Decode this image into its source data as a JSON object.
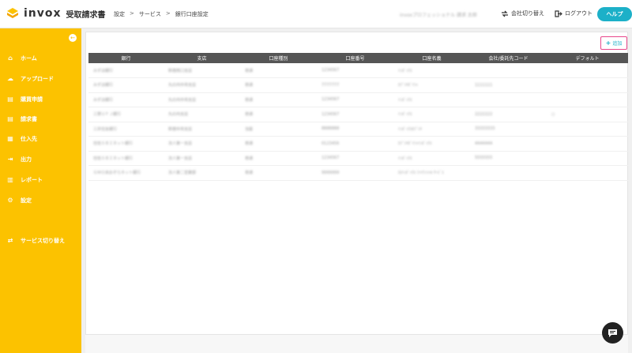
{
  "header": {
    "logo_text": "invox",
    "logo_sub": "受取請求書",
    "breadcrumb": [
      "設定",
      "サービス",
      "銀行口座設定"
    ],
    "breadcrumb_sep": ">",
    "user_name": "invoxプロフェッショナル 請求 太郎",
    "switch_company": "会社切り替え",
    "logout": "ログアウト",
    "help": "ヘルプ"
  },
  "sidebar": {
    "collapse_glyph": "←",
    "items": [
      {
        "label": "ホーム",
        "icon": "home-icon",
        "glyph": "⌂"
      },
      {
        "label": "アップロード",
        "icon": "upload-icon",
        "glyph": "☁"
      },
      {
        "label": "購買申請",
        "icon": "purchase-request-icon",
        "glyph": "▤"
      },
      {
        "label": "請求書",
        "icon": "invoice-icon",
        "glyph": "▤"
      },
      {
        "label": "仕入先",
        "icon": "supplier-icon",
        "glyph": "▦"
      },
      {
        "label": "出力",
        "icon": "export-icon",
        "glyph": "⇥"
      },
      {
        "label": "レポート",
        "icon": "report-icon",
        "glyph": "▥"
      },
      {
        "label": "設定",
        "icon": "settings-icon",
        "glyph": "⚙"
      },
      {
        "label": "サービス切り替え",
        "icon": "service-switch-icon",
        "glyph": "⇄"
      }
    ]
  },
  "main": {
    "add_button": "追加",
    "table": {
      "headers": [
        "銀行",
        "支店",
        "口座種別",
        "口座番号",
        "口座名義",
        "会社/委託先コード",
        "デフォルト"
      ],
      "rows": [
        [
          "みずほ銀行",
          "新宿西口支店",
          "普通",
          "1234567",
          "ｲﾝﾎﾞｯｸｽ",
          "",
          ""
        ],
        [
          "みずほ銀行",
          "丸の内中央支店",
          "普通",
          "7777777",
          "ｶﾌﾞｼｷｶﾞｲｼｬ",
          "1111111",
          ""
        ],
        [
          "みずほ銀行",
          "丸の内中央支店",
          "普通",
          "1234567",
          "ｲﾝﾎﾞｯｸｽ",
          "",
          ""
        ],
        [
          "三菱ＵＦＪ銀行",
          "丸の内支店",
          "普通",
          "1234567",
          "ｲﾝﾎﾞｯｸｽ",
          "2222222",
          "○"
        ],
        [
          "三井住友銀行",
          "新宿中央支店",
          "当座",
          "8888888",
          "ｲﾝﾎﾞｯｸｽｶﾌﾞｼｷ",
          "33333333",
          ""
        ],
        [
          "住信ＳＢＩネット銀行",
          "法人第一支店",
          "普通",
          "0123456",
          "ｶﾌﾞｼｷｶﾞｲｼｬｲﾝﾎﾞｯｸｽ",
          "4444444",
          ""
        ],
        [
          "住信ＳＢＩネット銀行",
          "法人第一支店",
          "普通",
          "1234567",
          "ｲﾝﾎﾞｯｸｽ",
          "5555555",
          ""
        ],
        [
          "ＧＭＯあおぞらネット銀行",
          "法人第二営業部",
          "普通",
          "9999999",
          "ｶ)ｲﾝﾎﾞｯｸｽ ﾌｧｲﾅﾝｼｬﾙ ｻｰﾋﾞｽ",
          "",
          ""
        ]
      ]
    }
  },
  "colors": {
    "sidebar": "#fcc200",
    "accent": "#1cb0c8",
    "highlight_border": "#e8478b",
    "table_header": "#555555"
  }
}
